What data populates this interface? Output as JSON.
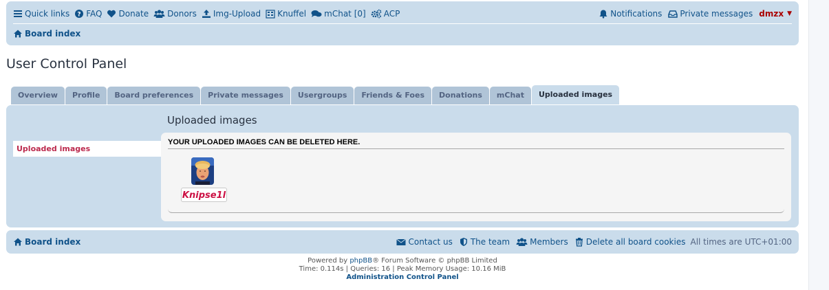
{
  "colors": {
    "link": "#105289",
    "header_bg": "#cadceb",
    "tab_bg": "#b0c4d7",
    "user": "#aa0000",
    "accent": "#bc2a4d"
  },
  "nav": {
    "left": [
      {
        "icon": "bars-icon",
        "label": "Quick links"
      },
      {
        "icon": "question-circle-icon",
        "label": "FAQ"
      },
      {
        "icon": "heart-icon",
        "label": "Donate"
      },
      {
        "icon": "users-icon",
        "label": "Donors"
      },
      {
        "icon": "upload-icon",
        "label": "Img-Upload"
      },
      {
        "icon": "calculator-icon",
        "label": "Knuffel"
      },
      {
        "icon": "comments-icon",
        "label": "mChat [0]"
      },
      {
        "icon": "cogs-icon",
        "label": "ACP"
      }
    ],
    "notifications": "Notifications",
    "private_messages": "Private messages",
    "username": "dmzx"
  },
  "breadcrumb": "Board index",
  "page_title": "User Control Panel",
  "tabs": [
    "Overview",
    "Profile",
    "Board preferences",
    "Private messages",
    "Usergroups",
    "Friends & Foes",
    "Donations",
    "mChat",
    "Uploaded images"
  ],
  "active_tab": "Uploaded images",
  "sidebar": {
    "items": [
      {
        "label": "Uploaded images"
      }
    ]
  },
  "main": {
    "section_title": "Uploaded images",
    "notice": "YOUR UPLOADED IMAGES CAN BE DELETED HERE.",
    "image_label": "Knipse1l"
  },
  "footer": {
    "breadcrumb": "Board index",
    "contact": "Contact us",
    "team": "The team",
    "members": "Members",
    "delete_cookies": "Delete all board cookies",
    "timezone": "All times are UTC+01:00"
  },
  "copyright": {
    "powered_prefix": "Powered by ",
    "phpbb": "phpBB",
    "powered_suffix": "® Forum Software © phpBB Limited",
    "stats": "Time: 0.114s | Queries: 16 | Peak Memory Usage: 10.16 MiB",
    "acp": "Administration Control Panel"
  }
}
